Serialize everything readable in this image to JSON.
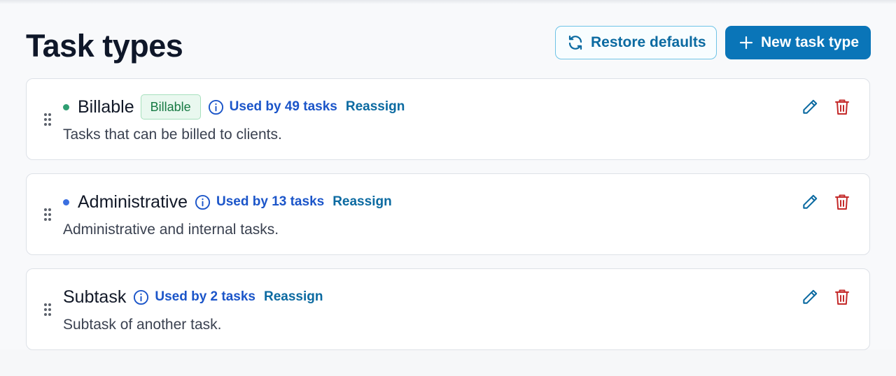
{
  "header": {
    "title": "Task types",
    "restore_label": "Restore defaults",
    "new_label": "New task type"
  },
  "colors": {
    "primary": "#0a75b8",
    "billable_dot": "#2f9e72",
    "administrative_dot": "#3b6fe0",
    "delete": "#c42a2a"
  },
  "task_types": [
    {
      "name": "Billable",
      "badge": "Billable",
      "dot_color": "#2f9e72",
      "usage": "Used by 49 tasks",
      "reassign": "Reassign",
      "description": "Tasks that can be billed to clients."
    },
    {
      "name": "Administrative",
      "dot_color": "#3b6fe0",
      "usage": "Used by 13 tasks",
      "reassign": "Reassign",
      "description": "Administrative and internal tasks."
    },
    {
      "name": "Subtask",
      "usage": "Used by 2 tasks",
      "reassign": "Reassign",
      "description": "Subtask of another task."
    }
  ],
  "icons": [
    "refresh-icon",
    "plus-icon",
    "drag-handle-icon",
    "info-icon",
    "pencil-icon",
    "trash-icon"
  ]
}
